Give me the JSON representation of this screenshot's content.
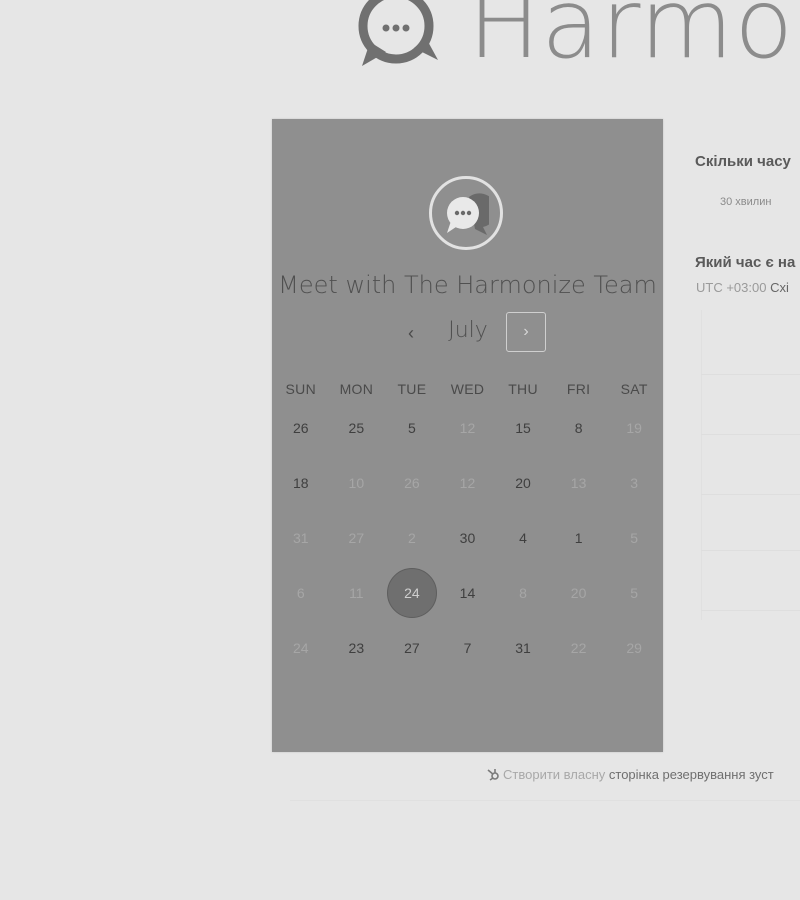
{
  "header": {
    "logo_text": "Harmor"
  },
  "card": {
    "title": "Meet with The Harmonize Team",
    "month": "July",
    "prev_glyph": "‹",
    "next_glyph": "›",
    "weekdays": [
      "SUN",
      "MON",
      "TUE",
      "WED",
      "THU",
      "FRI",
      "SAT"
    ],
    "weeks": [
      [
        {
          "t": "26",
          "d": false
        },
        {
          "t": "25",
          "d": false
        },
        {
          "t": "5",
          "d": false
        },
        {
          "t": "12",
          "d": true
        },
        {
          "t": "15",
          "d": false
        },
        {
          "t": "8",
          "d": false
        },
        {
          "t": "19",
          "d": true
        }
      ],
      [
        {
          "t": "18",
          "d": false
        },
        {
          "t": "10",
          "d": true
        },
        {
          "t": "26",
          "d": true
        },
        {
          "t": "12",
          "d": true
        },
        {
          "t": "20",
          "d": false
        },
        {
          "t": "13",
          "d": true
        },
        {
          "t": "3",
          "d": true
        }
      ],
      [
        {
          "t": "31",
          "d": true
        },
        {
          "t": "27",
          "d": true
        },
        {
          "t": "2",
          "d": true
        },
        {
          "t": "30",
          "d": false
        },
        {
          "t": "4",
          "d": false
        },
        {
          "t": "1",
          "d": false
        },
        {
          "t": "5",
          "d": true
        }
      ],
      [
        {
          "t": "6",
          "d": true
        },
        {
          "t": "11",
          "d": true
        },
        {
          "t": "24",
          "d": false,
          "s": true
        },
        {
          "t": "14",
          "d": false
        },
        {
          "t": "8",
          "d": true
        },
        {
          "t": "20",
          "d": true
        },
        {
          "t": "5",
          "d": true
        }
      ],
      [
        {
          "t": "24",
          "d": true
        },
        {
          "t": "23",
          "d": false
        },
        {
          "t": "27",
          "d": false
        },
        {
          "t": "7",
          "d": false
        },
        {
          "t": "31",
          "d": false
        },
        {
          "t": "22",
          "d": true
        },
        {
          "t": "29",
          "d": true
        }
      ]
    ]
  },
  "right": {
    "q_duration": "Скільки часу",
    "duration_value": "30 хвилин",
    "q_time": "Який час є на",
    "tz_offset": "UTC +03:00",
    "tz_name": "Схі"
  },
  "footer": {
    "create_link": "Створити власну",
    "booking_text": "сторінка резервування зуст"
  },
  "colors": {
    "card_bg": "#8f8f8f",
    "selected_day": "#6f6f6f"
  }
}
